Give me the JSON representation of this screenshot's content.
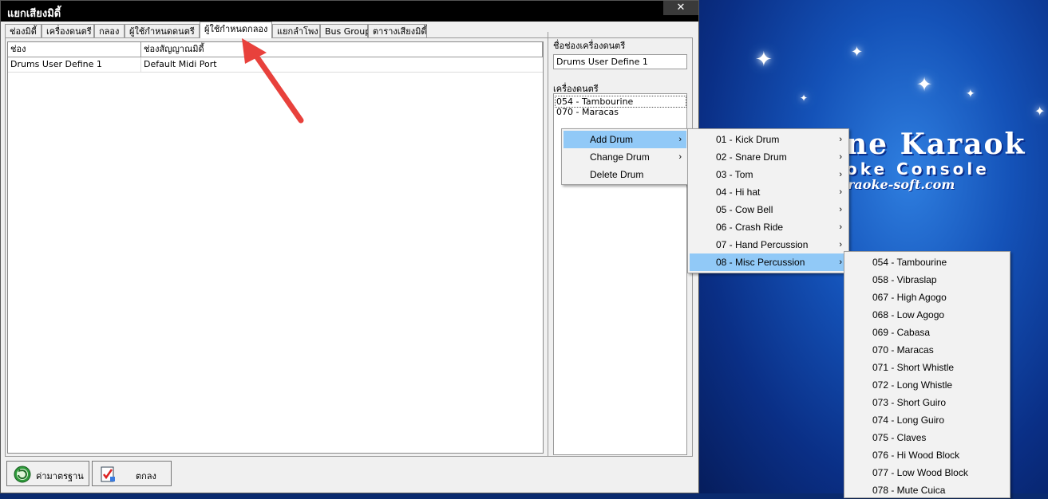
{
  "window": {
    "title": "แยกเสียงมิดี้",
    "close_symbol": "✕"
  },
  "tabs": [
    {
      "label": "ช่องมิดี้"
    },
    {
      "label": "เครื่องดนตรี"
    },
    {
      "label": "กลอง"
    },
    {
      "label": "ผู้ใช้กำหนดดนตรี"
    },
    {
      "label": "ผู้ใช้กำหนดกลอง"
    },
    {
      "label": "แยกลำโพง"
    },
    {
      "label": "Bus Group"
    },
    {
      "label": "ตารางเสียงมิดี้"
    }
  ],
  "table": {
    "columns": [
      "ช่อง",
      "ช่องสัญญาณมิดี้"
    ],
    "rows": [
      [
        "Drums User Define 1",
        "Default Midi Port"
      ]
    ]
  },
  "right_panel": {
    "name_label": "ชื่อช่องเครื่องดนตรี",
    "name_value": "Drums User Define 1",
    "instruments_label": "เครื่องดนตรี",
    "instruments": [
      "054 - Tambourine",
      "070 - Maracas"
    ]
  },
  "buttons": {
    "default_label": "ค่ามาตรฐาน",
    "ok_label": "ตกลง"
  },
  "context_menu": {
    "items": [
      "Add Drum",
      "Change Drum",
      "Delete Drum"
    ]
  },
  "drum_groups": [
    "01 - Kick Drum",
    "02 - Snare Drum",
    "03 - Tom",
    "04 - Hi hat",
    "05 - Cow Bell",
    "06 - Crash Ride",
    "07 - Hand Percussion",
    "08 - Misc Percussion"
  ],
  "misc_percussion": [
    "054 - Tambourine",
    "058 - Vibraslap",
    "067 - High Agogo",
    "068 - Low Agogo",
    "069 - Cabasa",
    "070 - Maracas",
    "071 - Short Whistle",
    "072 - Long Whistle",
    "073 - Short Guiro",
    "074 - Long Guiro",
    "075 - Claves",
    "076 - Hi Wood Block",
    "077 - Low Wood Block",
    "078 - Mute Cuica"
  ],
  "desktop": {
    "line1": "ne Karaok",
    "line2": "oke  Console",
    "line3": "raoke-soft.com"
  },
  "colors": {
    "highlight": "#91c9f7",
    "annotation_arrow": "#e8413c"
  }
}
